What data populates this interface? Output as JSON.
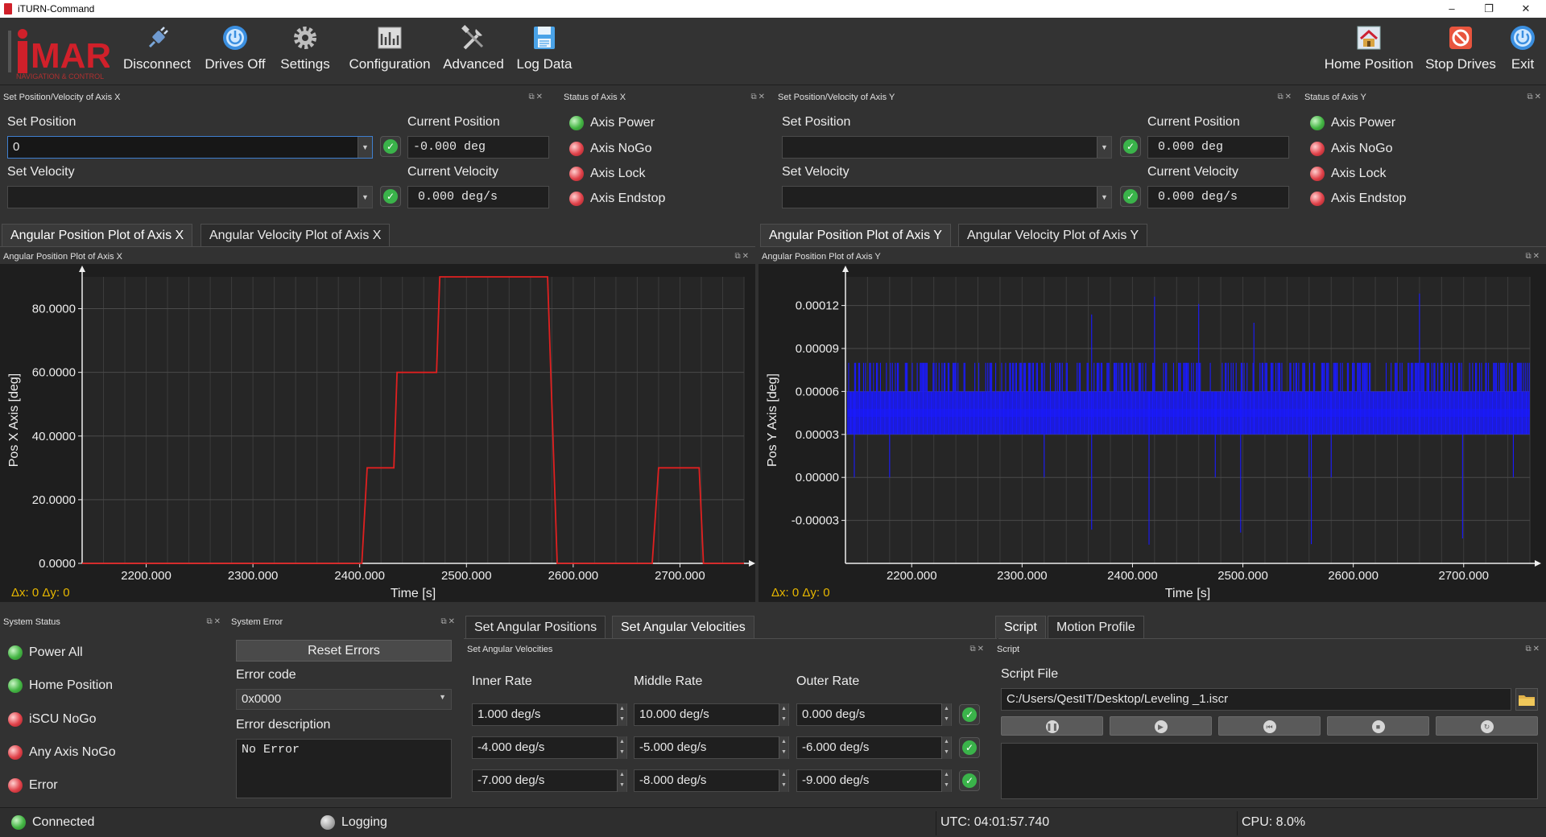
{
  "window": {
    "title": "iTURN-Command",
    "minimize": "–",
    "maximize": "❐",
    "close": "✕"
  },
  "toolbar": {
    "logo_text": "iMAR",
    "logo_sub": "NAVIGATION & CONTROL",
    "left_buttons": [
      {
        "label": "Disconnect",
        "icon": "plug-icon"
      },
      {
        "label": "Drives Off",
        "icon": "power-icon"
      },
      {
        "label": "Settings",
        "icon": "gear-icon"
      },
      {
        "label": "Configuration",
        "icon": "configuration-icon"
      },
      {
        "label": "Advanced",
        "icon": "tools-icon"
      },
      {
        "label": "Log Data",
        "icon": "floppy-icon"
      }
    ],
    "right_buttons": [
      {
        "label": "Home Position",
        "icon": "home-icon"
      },
      {
        "label": "Stop Drives",
        "icon": "stop-icon"
      },
      {
        "label": "Exit",
        "icon": "exit-icon"
      }
    ]
  },
  "axis_x": {
    "set_dock_title": "Set Position/Velocity of Axis X",
    "status_dock_title": "Status of Axis X",
    "set_position_label": "Set Position",
    "set_position_value": "0",
    "set_velocity_label": "Set Velocity",
    "set_velocity_value": "",
    "current_position_label": "Current Position",
    "current_position_value": "-0.000 deg",
    "current_velocity_label": "Current Velocity",
    "current_velocity_value": "0.000 deg/s",
    "status": [
      {
        "label": "Axis Power",
        "color": "green"
      },
      {
        "label": "Axis NoGo",
        "color": "red"
      },
      {
        "label": "Axis Lock",
        "color": "red"
      },
      {
        "label": "Axis Endstop",
        "color": "red"
      }
    ],
    "tabs": [
      "Angular Position Plot of Axis X",
      "Angular Velocity Plot of Axis X"
    ],
    "plot_dock_title": "Angular Position Plot of Axis X",
    "delta_readout": "Δx: 0 Δy: 0"
  },
  "axis_y": {
    "set_dock_title": "Set Position/Velocity of Axis Y",
    "status_dock_title": "Status of Axis Y",
    "set_position_label": "Set Position",
    "set_position_value": "",
    "set_velocity_label": "Set Velocity",
    "set_velocity_value": "",
    "current_position_label": "Current Position",
    "current_position_value": "0.000 deg",
    "current_velocity_label": "Current Velocity",
    "current_velocity_value": "0.000 deg/s",
    "status": [
      {
        "label": "Axis Power",
        "color": "green"
      },
      {
        "label": "Axis NoGo",
        "color": "red"
      },
      {
        "label": "Axis Lock",
        "color": "red"
      },
      {
        "label": "Axis Endstop",
        "color": "red"
      }
    ],
    "tabs": [
      "Angular Position Plot of Axis Y",
      "Angular Velocity Plot of Axis Y"
    ],
    "plot_dock_title": "Angular Position Plot of Axis Y",
    "delta_readout": "Δx: 0 Δy: 0"
  },
  "chart_data": [
    {
      "type": "line",
      "xlabel": "Time [s]",
      "ylabel": "Pos X Axis [deg]",
      "xlim": [
        2140,
        2760
      ],
      "ylim": [
        0,
        90
      ],
      "xticks": [
        "2200.000",
        "2300.000",
        "2400.000",
        "2500.000",
        "2600.000",
        "2700.000"
      ],
      "yticks": [
        "0.0000",
        "20.0000",
        "40.0000",
        "60.0000",
        "80.0000"
      ],
      "grid": true,
      "color": "#e02020",
      "x": [
        2140,
        2402,
        2407,
        2432,
        2435,
        2472,
        2475,
        2576,
        2585,
        2674,
        2680,
        2718,
        2722,
        2760
      ],
      "y": [
        0,
        0,
        30,
        30,
        60,
        60,
        90,
        90,
        0,
        0,
        30,
        30,
        0,
        0
      ]
    },
    {
      "type": "line",
      "xlabel": "Time [s]",
      "ylabel": "Pos Y Axis [deg]",
      "xlim": [
        2140,
        2760
      ],
      "ylim": [
        -6e-05,
        0.00014
      ],
      "xticks": [
        "2200.000",
        "2300.000",
        "2400.000",
        "2500.000",
        "2600.000",
        "2700.000"
      ],
      "yticks": [
        "-0.00003",
        "0.00000",
        "0.00003",
        "0.00006",
        "0.00009",
        "0.00012"
      ],
      "grid": true,
      "color": "#1a1aff",
      "baseline_low": 3e-05,
      "baseline_high": 6e-05,
      "upper_band": 8e-05,
      "spikes_high": [
        2363,
        2420,
        2460,
        2510,
        2660
      ],
      "spikes_low": [
        2363,
        2415,
        2498,
        2562,
        2699
      ]
    }
  ],
  "system_status": {
    "dock_title": "System Status",
    "items": [
      {
        "label": "Power All",
        "color": "green"
      },
      {
        "label": "Home Position",
        "color": "green"
      },
      {
        "label": "iSCU NoGo",
        "color": "red"
      },
      {
        "label": "Any Axis NoGo",
        "color": "red"
      },
      {
        "label": "Error",
        "color": "red"
      }
    ]
  },
  "system_error": {
    "dock_title": "System Error",
    "reset_label": "Reset Errors",
    "error_code_label": "Error code",
    "error_code_value": "0x0000",
    "error_description_label": "Error description",
    "error_description_value": "No Error"
  },
  "angular": {
    "tabs": [
      "Set Angular Positions",
      "Set Angular Velocities"
    ],
    "dock_title": "Set Angular Velocities",
    "columns": [
      "Inner Rate",
      "Middle Rate",
      "Outer Rate"
    ],
    "rows": [
      [
        "1.000 deg/s",
        "10.000 deg/s",
        "0.000 deg/s"
      ],
      [
        "-4.000 deg/s",
        "-5.000 deg/s",
        "-6.000 deg/s"
      ],
      [
        "-7.000 deg/s",
        "-8.000 deg/s",
        "-9.000 deg/s"
      ]
    ]
  },
  "script": {
    "tabs": [
      "Script",
      "Motion Profile"
    ],
    "dock_title": "Script",
    "file_label": "Script File",
    "file_path": "C:/Users/QestIT/Desktop/Leveling _1.iscr",
    "controls": [
      "pause-icon",
      "play-icon",
      "skip-back-icon",
      "stop-icon",
      "repeat-icon"
    ]
  },
  "statusbar": {
    "connected": "Connected",
    "logging": "Logging",
    "utc": "UTC: 04:01:57.740",
    "cpu": "CPU: 8.0%"
  }
}
